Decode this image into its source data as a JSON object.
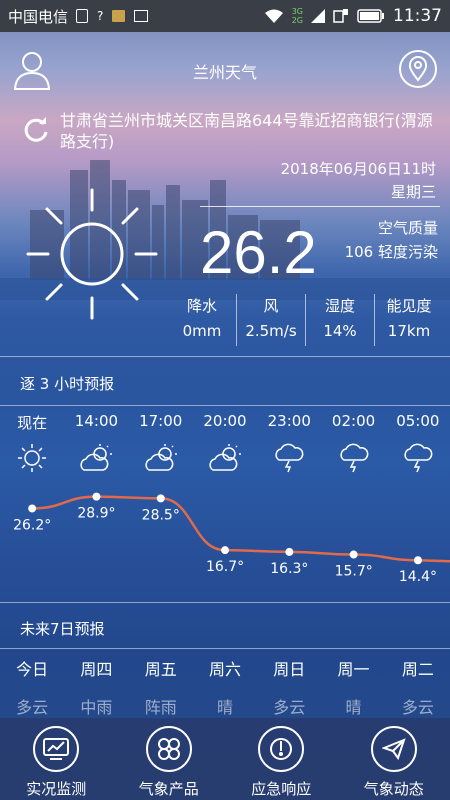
{
  "status_bar": {
    "carrier": "中国电信",
    "network_3g": "3G",
    "network_2g": "2G",
    "time": "11:37"
  },
  "header": {
    "title": "兰州天气"
  },
  "location": {
    "address": "甘肃省兰州市城关区南昌路644号靠近招商银行(渭源路支行)"
  },
  "current": {
    "datetime": "2018年06月06日11时",
    "weekday": "星期三",
    "temperature": "26.2",
    "air_quality_label": "空气质量",
    "air_quality_value": "106 轻度污染",
    "icon": "sun-icon"
  },
  "metrics": [
    {
      "label": "降水",
      "value": "0mm"
    },
    {
      "label": "风",
      "value": "2.5m/s"
    },
    {
      "label": "湿度",
      "value": "14%"
    },
    {
      "label": "能见度",
      "value": "17km"
    }
  ],
  "hourly": {
    "section_title": "逐 3 小时预报",
    "hours": [
      {
        "time": "现在",
        "icon": "sun-icon",
        "temp": "26.2°",
        "value": 26.2
      },
      {
        "time": "14:00",
        "icon": "partly-cloudy-icon",
        "temp": "28.9°",
        "value": 28.9
      },
      {
        "time": "17:00",
        "icon": "partly-cloudy-icon",
        "temp": "28.5°",
        "value": 28.5
      },
      {
        "time": "20:00",
        "icon": "partly-cloudy-icon",
        "temp": "16.7°",
        "value": 16.7
      },
      {
        "time": "23:00",
        "icon": "thunder-rain-icon",
        "temp": "16.3°",
        "value": 16.3
      },
      {
        "time": "02:00",
        "icon": "thunder-rain-icon",
        "temp": "15.7°",
        "value": 15.7
      },
      {
        "time": "05:00",
        "icon": "thunder-rain-icon",
        "temp": "14.4°",
        "value": 14.4
      }
    ],
    "line_color": "#e06a4a"
  },
  "weekly": {
    "section_title": "未来7日预报",
    "days": [
      {
        "day": "今日",
        "cond": "多云"
      },
      {
        "day": "周四",
        "cond": "中雨"
      },
      {
        "day": "周五",
        "cond": "阵雨"
      },
      {
        "day": "周六",
        "cond": "晴"
      },
      {
        "day": "周日",
        "cond": "多云"
      },
      {
        "day": "周一",
        "cond": "晴"
      },
      {
        "day": "周二",
        "cond": "多云"
      }
    ]
  },
  "bottom_nav": [
    {
      "label": "实况监测",
      "icon": "chart-monitor-icon"
    },
    {
      "label": "气象产品",
      "icon": "grid-petals-icon"
    },
    {
      "label": "应急响应",
      "icon": "gauge-icon"
    },
    {
      "label": "气象动态",
      "icon": "paper-plane-icon"
    }
  ]
}
